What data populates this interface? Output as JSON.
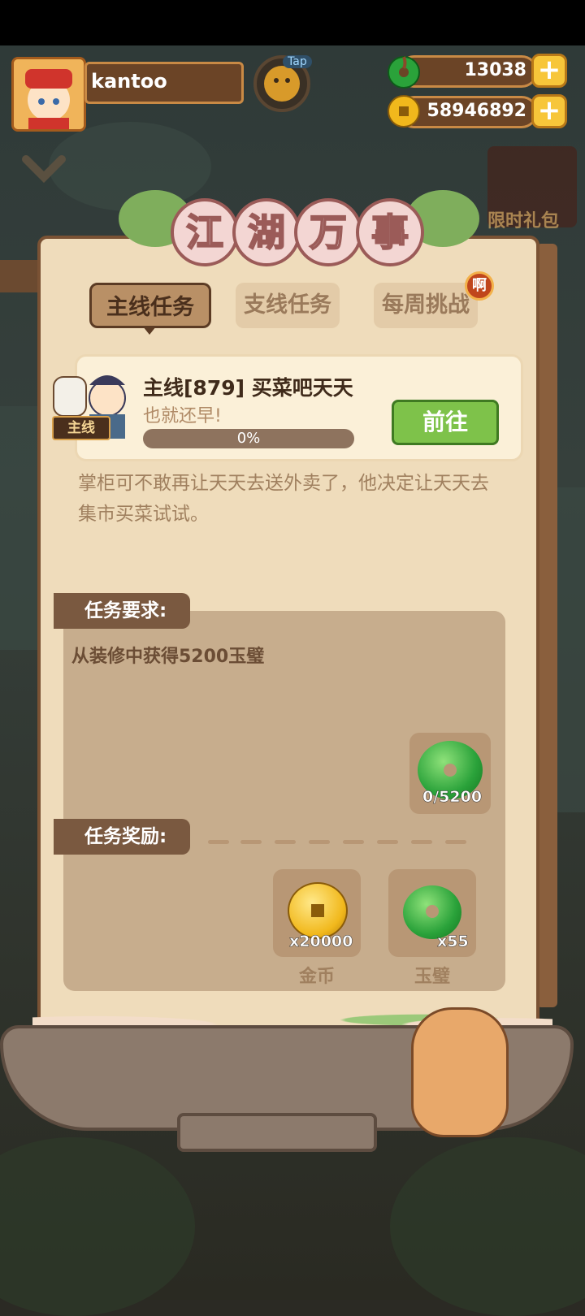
{
  "player": {
    "name": "kantoo"
  },
  "top_bar": {
    "tap_label": "Tap"
  },
  "currencies": {
    "jade": {
      "value": "13038",
      "icon": "jade-icon"
    },
    "gold": {
      "value": "58946892",
      "icon": "coin-icon"
    }
  },
  "side_promo": "限时礼包",
  "title": {
    "chars": [
      "江",
      "湖",
      "万",
      "事"
    ]
  },
  "tabs": [
    {
      "label": "主线任务",
      "active": true
    },
    {
      "label": "支线任务",
      "active": false
    },
    {
      "label": "每周挑战",
      "active": false
    }
  ],
  "tab_badge": "啊",
  "quest": {
    "tag": "主线",
    "title": "主线[879] 买菜吧天天",
    "subtitle": "也就还早!",
    "progress_text": "0%",
    "progress": 0,
    "go_label": "前往",
    "description": "掌柜可不敢再让天天去送外卖了，他决定让天天去集市买菜试试。"
  },
  "requirements": {
    "label": "任务要求:",
    "text": "从装修中获得5200玉璧",
    "item": {
      "icon": "jade-icon",
      "count": "0/5200"
    }
  },
  "rewards": {
    "label": "任务奖励:",
    "items": [
      {
        "icon": "coin-icon",
        "count": "x20000",
        "name": "金币"
      },
      {
        "icon": "jade-icon",
        "count": "x55",
        "name": "玉璧"
      }
    ]
  }
}
